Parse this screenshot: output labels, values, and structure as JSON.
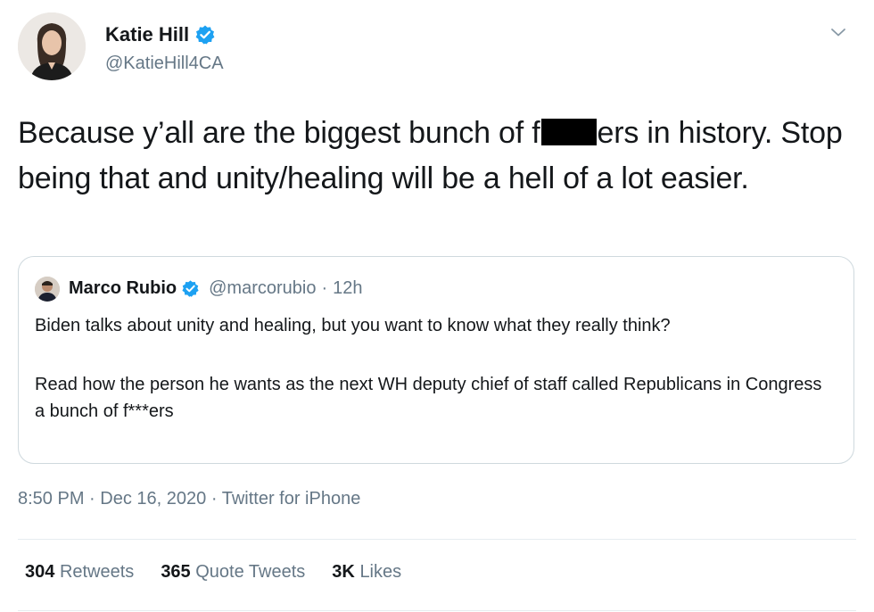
{
  "author": {
    "name": "Katie Hill",
    "handle": "@KatieHill4CA"
  },
  "tweet": {
    "text_part1": "Because y’all are the biggest bunch of f",
    "text_part2": "ers in history. Stop being that and unity/healing will be a hell of a lot easier."
  },
  "quoted": {
    "name": "Marco Rubio",
    "handle": "@marcorubio",
    "separator": "·",
    "age": "12h",
    "paragraph1": "Biden talks about unity and healing, but you want to know what they really think?",
    "paragraph2": "Read how the person he wants as the next WH deputy chief of staff called Republicans in Congress a bunch of f***ers"
  },
  "meta": {
    "time": "8:50 PM",
    "dot1": "·",
    "date": "Dec 16, 2020",
    "dot2": "·",
    "source": "Twitter for iPhone"
  },
  "stats": {
    "retweets_count": "304",
    "retweets_label": "Retweets",
    "quotes_count": "365",
    "quotes_label": "Quote Tweets",
    "likes_count": "3K",
    "likes_label": "Likes"
  },
  "colors": {
    "verified_blue": "#1da1f2",
    "secondary_text": "#657786",
    "primary_text": "#14171a",
    "border": "#cfd9de"
  },
  "icons": {
    "verified": "verified-badge-icon",
    "caret": "chevron-down-icon"
  }
}
